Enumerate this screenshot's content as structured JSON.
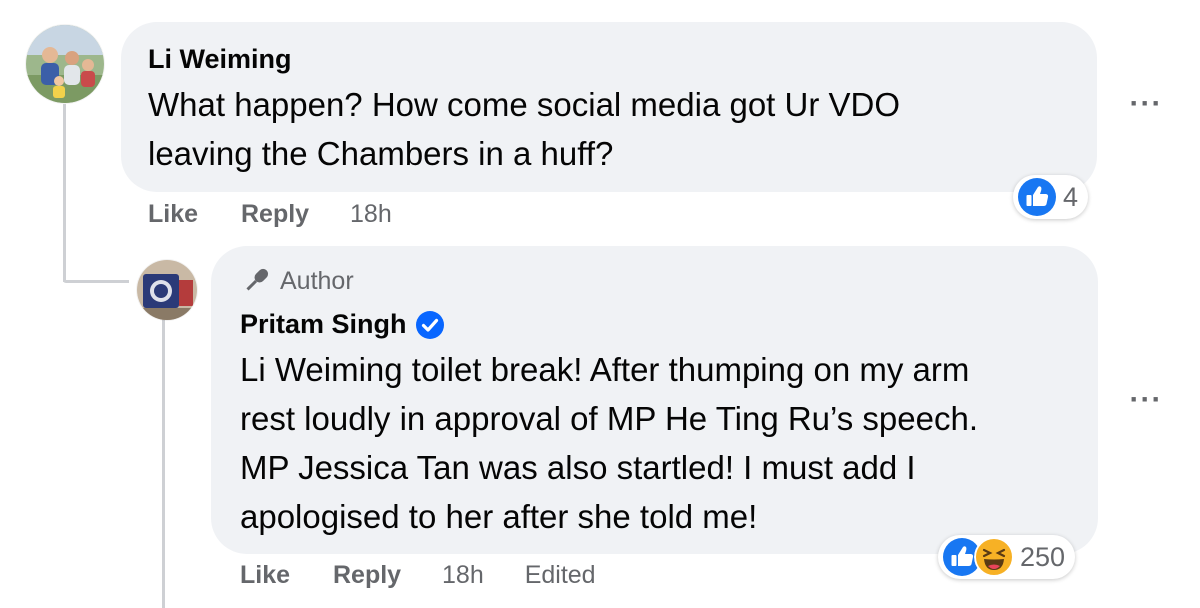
{
  "comments": [
    {
      "author": "Li Weiming",
      "text_lines": [
        "What happen? How come social media got Ur VDO",
        "leaving the Chambers in a huff?"
      ],
      "actions": {
        "like": "Like",
        "reply": "Reply",
        "time": "18h"
      },
      "reaction_count": "4",
      "reaction_icons": [
        "like-icon"
      ]
    },
    {
      "badge": "Author",
      "author": "Pritam Singh",
      "verified": true,
      "text_lines": [
        "Li Weiming toilet break! After thumping on my arm",
        "rest loudly in approval of MP He Ting Ru’s speech.",
        "MP Jessica Tan was also startled! I must add I",
        "apologised to her after she told me!"
      ],
      "actions": {
        "like": "Like",
        "reply": "Reply",
        "time": "18h",
        "edited": "Edited"
      },
      "reaction_count": "250",
      "reaction_icons": [
        "like-icon",
        "haha-icon"
      ]
    }
  ],
  "more_label": "···",
  "colors": {
    "like_blue": "#0866ff",
    "bubble_bg": "#f0f2f5",
    "meta_gray": "#65676b",
    "haha_yellow": "#f7b125"
  }
}
